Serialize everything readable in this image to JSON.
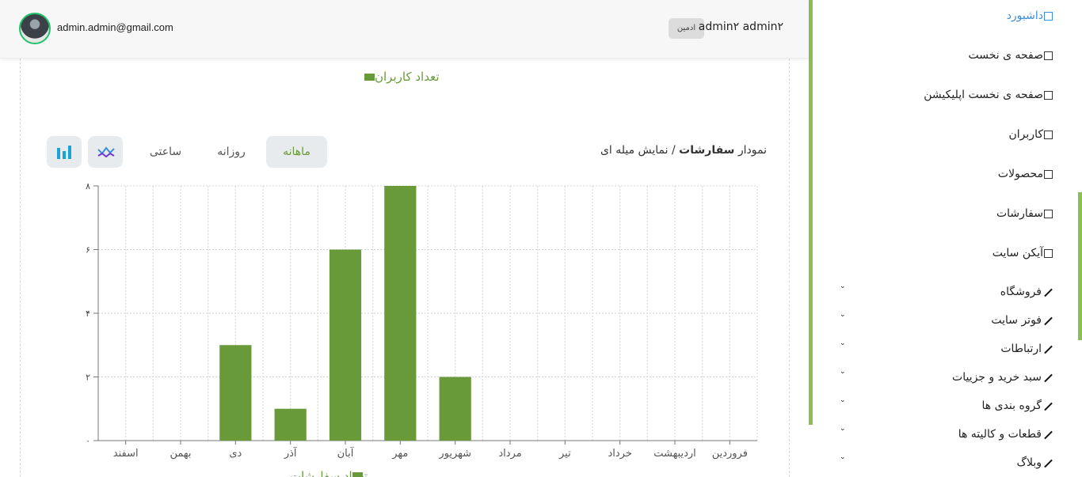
{
  "header": {
    "email": "admin.admin@gmail.com",
    "user_name": "admin۲ admin۲",
    "role_badge": "ادمین"
  },
  "main": {
    "users_legend": "تعداد کاربران",
    "chart_title_prefix": "نمودار",
    "chart_title_bold": "سفارشات",
    "chart_title_suffix": " / نمایش میله ای",
    "tabs": [
      "ماهانه",
      "روزانه",
      "ساعتی"
    ],
    "active_tab": "ماهانه",
    "orders_legend": "تعداد سفارشات"
  },
  "chart_data": {
    "type": "bar",
    "categories": [
      "فروردین",
      "اردیبهشت",
      "خرداد",
      "تیر",
      "مرداد",
      "شهریور",
      "مهر",
      "آبان",
      "آذر",
      "دی",
      "بهمن",
      "اسفند"
    ],
    "values": [
      0,
      0,
      0,
      0,
      0,
      2,
      8,
      6,
      1,
      3,
      0,
      0
    ],
    "y_tick_labels": [
      "۰",
      "۲",
      "۴",
      "۶",
      "۸"
    ],
    "ylim": [
      0,
      8
    ],
    "series": [
      {
        "name": "تعداد سفارشات",
        "values": [
          0,
          0,
          0,
          0,
          0,
          2,
          8,
          6,
          1,
          3,
          0,
          0
        ]
      }
    ],
    "bar_color": "#699a3a",
    "grid": true,
    "legend_position": "bottom"
  },
  "sidebar": {
    "items": [
      {
        "label": "داشبورد",
        "icon": "box-icon",
        "active": true
      },
      {
        "label": "صفحه ی نخست",
        "icon": "box-icon"
      },
      {
        "label": "صفحه ی نخست اپلیکیشن",
        "icon": "box-icon"
      },
      {
        "label": "کاربران",
        "icon": "box-icon"
      },
      {
        "label": "محصولات",
        "icon": "box-icon"
      },
      {
        "label": "سفارشات",
        "icon": "box-icon"
      },
      {
        "label": "آیکن سایت",
        "icon": "box-icon"
      },
      {
        "label": "فروشگاه",
        "icon": "wand-icon",
        "expandable": true
      },
      {
        "label": "فوتر سایت",
        "icon": "wand-icon",
        "expandable": true
      },
      {
        "label": "ارتباطات",
        "icon": "wand-icon",
        "expandable": true
      },
      {
        "label": "سبد خرید و جزییات",
        "icon": "wand-icon",
        "expandable": true
      },
      {
        "label": "گروه بندی ها",
        "icon": "wand-icon",
        "expandable": true
      },
      {
        "label": "قطعات و کالیته ها",
        "icon": "wand-icon",
        "expandable": true
      },
      {
        "label": "وبلاگ",
        "icon": "wand-icon",
        "expandable": true
      }
    ]
  },
  "colors": {
    "accent_green": "#88c057",
    "bar_green": "#699a3a",
    "active_link": "#3a8fd8"
  }
}
